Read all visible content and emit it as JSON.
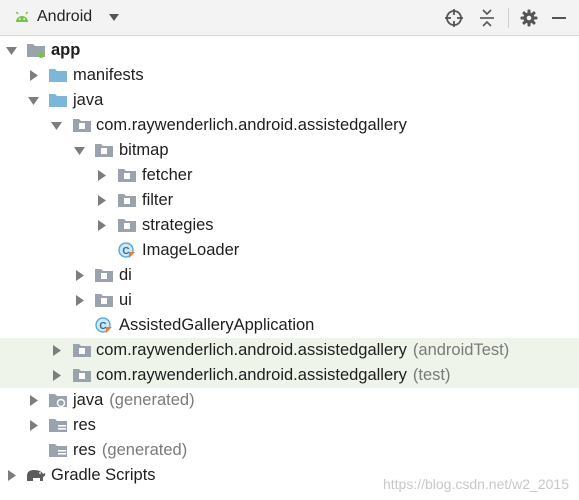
{
  "toolbar": {
    "view_label": "Android",
    "icons": [
      "android-icon",
      "dropdown-icon",
      "locate-icon",
      "collapse-all-icon",
      "gear-icon",
      "minimize-icon"
    ]
  },
  "tree": {
    "app": "app",
    "manifests": "manifests",
    "java": "java",
    "pkg_main": "com.raywenderlich.android.assistedgallery",
    "bitmap": "bitmap",
    "fetcher": "fetcher",
    "filter": "filter",
    "strategies": "strategies",
    "image_loader": "ImageLoader",
    "di": "di",
    "ui": "ui",
    "app_class": "AssistedGalleryApplication",
    "pkg_android_test": "com.raywenderlich.android.assistedgallery",
    "pkg_android_test_suffix": "(androidTest)",
    "pkg_test": "com.raywenderlich.android.assistedgallery",
    "pkg_test_suffix": "(test)",
    "java_generated": "java",
    "java_generated_suffix": "(generated)",
    "res": "res",
    "res_generated": "res",
    "res_generated_suffix": "(generated)",
    "gradle_scripts": "Gradle Scripts"
  },
  "watermark": "https://blog.csdn.net/w2_2015",
  "colors": {
    "folder": "#7cb7d9",
    "package": "#9aa3ad",
    "highlight_row": "#eef4e9",
    "android_green": "#7cc24a",
    "class_blue": "#4aa3d9"
  }
}
